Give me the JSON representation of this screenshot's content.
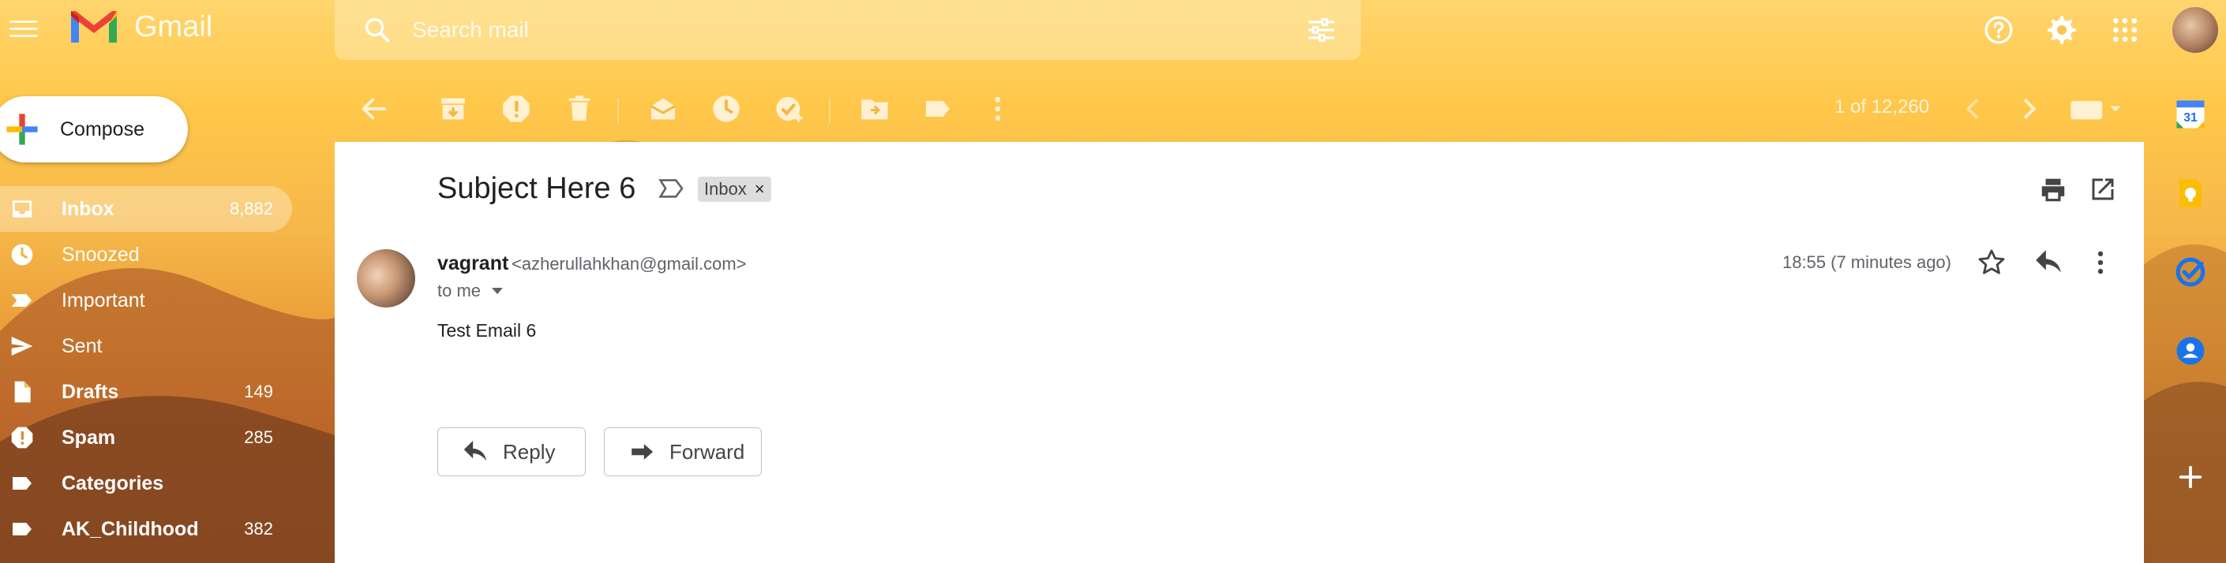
{
  "app": {
    "name": "Gmail",
    "search_placeholder": "Search mail"
  },
  "compose": {
    "label": "Compose"
  },
  "sidebar": {
    "items": [
      {
        "label": "Inbox",
        "count": "8,882",
        "active": true,
        "bold": true
      },
      {
        "label": "Snoozed",
        "count": "",
        "bold": false
      },
      {
        "label": "Important",
        "count": "",
        "bold": false
      },
      {
        "label": "Sent",
        "count": "",
        "bold": false
      },
      {
        "label": "Drafts",
        "count": "149",
        "bold": true
      },
      {
        "label": "Spam",
        "count": "285",
        "bold": true
      },
      {
        "label": "Categories",
        "count": "",
        "bold": true
      },
      {
        "label": "AK_Childhood",
        "count": "382",
        "bold": true
      }
    ]
  },
  "toolbar": {
    "pager": "1 of 12,260"
  },
  "message": {
    "subject": "Subject Here 6",
    "label_chip": "Inbox",
    "label_chip_close": "×",
    "sender_name": "vagrant",
    "sender_email": "<azherullahkhan@gmail.com>",
    "recipient": "to me",
    "timestamp": "18:55 (7 minutes ago)",
    "body": "Test Email 6"
  },
  "actions": {
    "reply_label": "Reply",
    "forward_label": "Forward"
  },
  "colors": {
    "accent_blue": "#1a73e8",
    "gmail_red": "#ea4335",
    "keep_yellow": "#fbbc04",
    "text_primary": "#202124",
    "text_secondary": "#5f6368"
  }
}
